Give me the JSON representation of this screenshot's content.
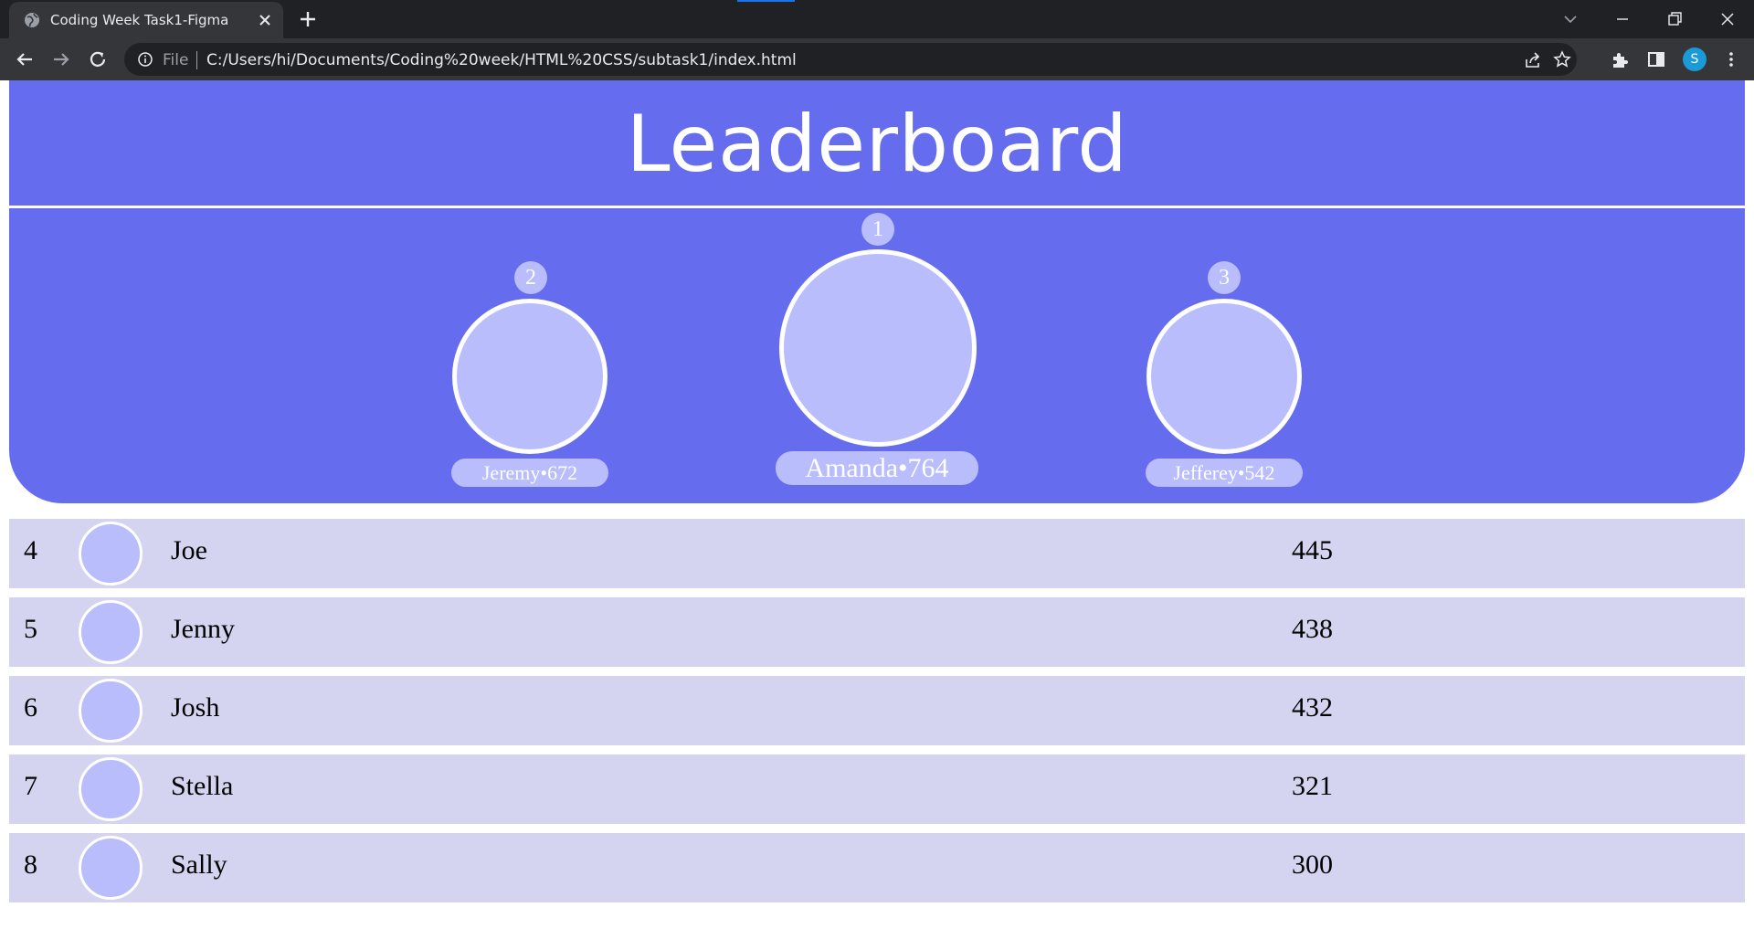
{
  "browser": {
    "tab_title": "Coding Week Task1-Figma",
    "omnibox": {
      "scheme_label": "File",
      "url": "C:/Users/hi/Documents/Coding%20week/HTML%20CSS/subtask1/index.html"
    },
    "profile_initial": "S"
  },
  "page": {
    "title": "Leaderboard",
    "podium": [
      {
        "rank": "1",
        "label": "Amanda•764"
      },
      {
        "rank": "2",
        "label": "Jeremy•672"
      },
      {
        "rank": "3",
        "label": "Jefferey•542"
      }
    ],
    "rows": [
      {
        "rank": "4",
        "name": "Joe",
        "score": "445"
      },
      {
        "rank": "5",
        "name": "Jenny",
        "score": "438"
      },
      {
        "rank": "6",
        "name": "Josh",
        "score": "432"
      },
      {
        "rank": "7",
        "name": "Stella",
        "score": "321"
      },
      {
        "rank": "8",
        "name": "Sally",
        "score": "300"
      }
    ]
  },
  "colors": {
    "hero_bg": "#656ced",
    "avatar_fill": "#b9bdfc",
    "row_bg": "#d4d4f0",
    "chrome_dark": "#202124",
    "chrome_toolbar": "#35363a"
  }
}
